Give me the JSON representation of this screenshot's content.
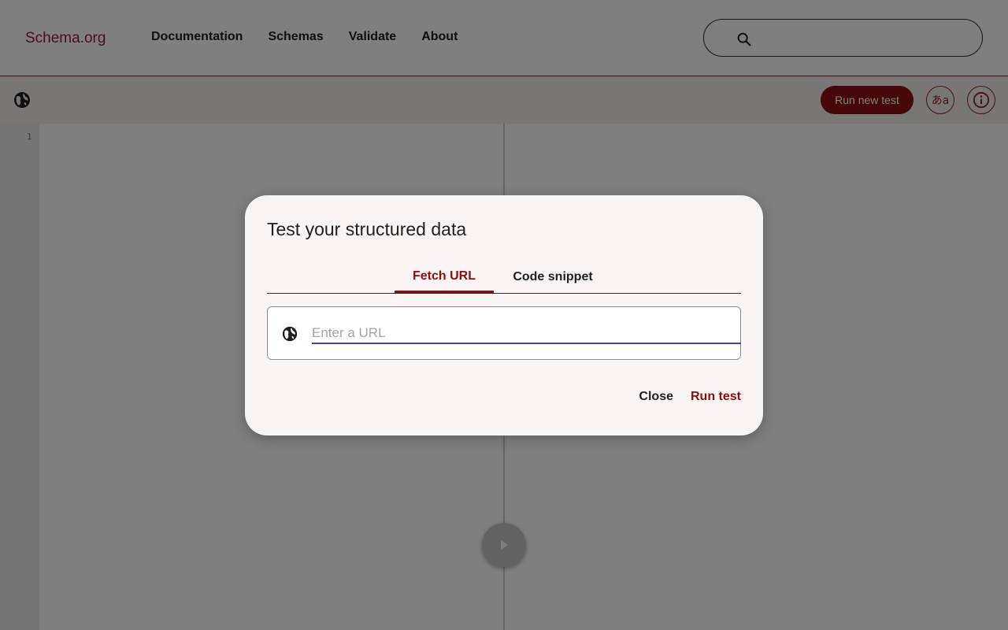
{
  "header": {
    "logo": "Schema.org",
    "nav": [
      "Documentation",
      "Schemas",
      "Validate",
      "About"
    ],
    "search_placeholder": ""
  },
  "toolbar": {
    "run_new_test_label": "Run new test",
    "language_label": "あa",
    "info_icon": "info-icon",
    "globe_icon": "globe-icon"
  },
  "editor": {
    "line_numbers": [
      "1"
    ]
  },
  "dialog": {
    "title": "Test your structured data",
    "tabs": [
      "Fetch URL",
      "Code snippet"
    ],
    "active_tab": "Fetch URL",
    "url_placeholder": "Enter a URL",
    "url_value": "",
    "close_label": "Close",
    "run_test_label": "Run test"
  },
  "colors": {
    "brand": "#8a0e0e",
    "input_underline": "#3f3fb0"
  }
}
